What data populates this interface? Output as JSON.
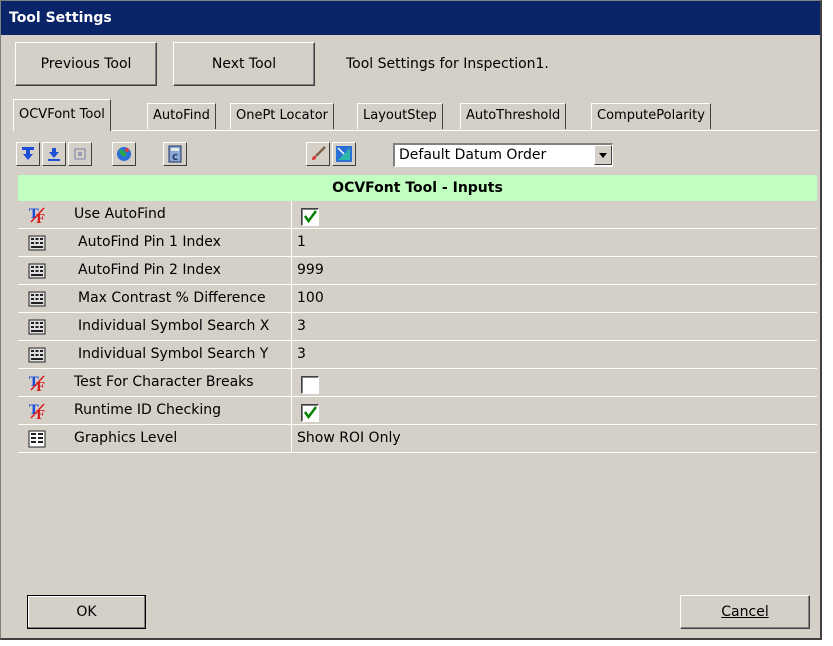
{
  "window": {
    "title": "Tool Settings"
  },
  "top_bar": {
    "previous_label": "Previous Tool",
    "next_label": "Next Tool",
    "info_text": "Tool Settings for Inspection1."
  },
  "tabs": [
    {
      "label": "OCVFont Tool",
      "active": true
    },
    {
      "label": "AutoFind"
    },
    {
      "label": "OnePt Locator"
    },
    {
      "label": "LayoutStep"
    },
    {
      "label": "AutoThreshold"
    },
    {
      "label": "ComputePolarity"
    }
  ],
  "toolbar": {
    "datum_order_value": "Default Datum Order",
    "icons": [
      "down-arrow-icon",
      "down-arrow-icon",
      "disabled-icon",
      "globe-icon",
      "calculator-icon",
      "brush-icon",
      "ruler-icon"
    ]
  },
  "grid": {
    "header": "OCVFont Tool - Inputs",
    "rows": [
      {
        "icon": "boolean-icon",
        "label": "Use AutoFind",
        "type": "check",
        "checked": true
      },
      {
        "icon": "keypad-icon",
        "label": "AutoFind Pin 1 Index",
        "type": "text",
        "value": "1"
      },
      {
        "icon": "keypad-icon",
        "label": "AutoFind Pin 2 Index",
        "type": "text",
        "value": "999"
      },
      {
        "icon": "keypad-icon",
        "label": "Max Contrast % Difference",
        "type": "text",
        "value": "100"
      },
      {
        "icon": "keypad-icon",
        "label": "Individual Symbol Search X",
        "type": "text",
        "value": "3"
      },
      {
        "icon": "keypad-icon",
        "label": "Individual Symbol Search Y",
        "type": "text",
        "value": "3"
      },
      {
        "icon": "boolean-icon",
        "label": "Test For Character Breaks",
        "type": "check",
        "checked": false
      },
      {
        "icon": "boolean-icon",
        "label": "Runtime ID Checking",
        "type": "check",
        "checked": true
      },
      {
        "icon": "list-icon",
        "label": "Graphics Level",
        "type": "text",
        "value": "Show ROI Only"
      }
    ]
  },
  "buttons": {
    "ok_label": "OK",
    "cancel_label": "Cancel"
  },
  "colors": {
    "title_bg": "#0a246a",
    "header_bg": "#c0ffc0",
    "face": "#d4d0c8",
    "check_green": "#008000"
  }
}
